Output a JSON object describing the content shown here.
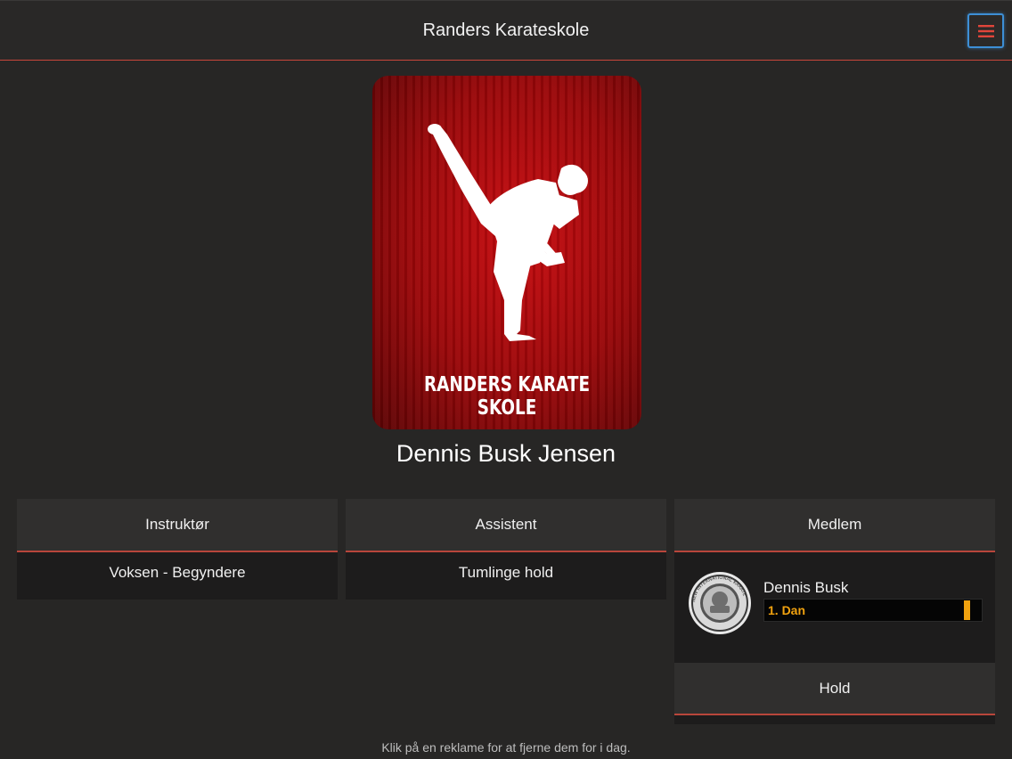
{
  "header": {
    "title": "Randers Karateskole",
    "menu_icon": "hamburger-menu-icon"
  },
  "logo": {
    "text": "RANDERS KARATE SKOLE"
  },
  "profile": {
    "name": "Dennis Busk Jensen"
  },
  "roles": [
    {
      "title": "Instruktør",
      "team": "Voksen - Begyndere"
    },
    {
      "title": "Assistent",
      "team": "Tumlinge hold"
    }
  ],
  "member": {
    "title": "Medlem",
    "name": "Dennis Busk",
    "rank": "1. Dan",
    "rank_color": "#f1a20f",
    "emblem_text": "NEW INTERNATIONAL KARATE",
    "team_label": "Hold"
  },
  "footer": {
    "ad_hint": "Klik på en reklame for at fjerne dem for i dag."
  },
  "colors": {
    "accent": "#c8463a",
    "focus": "#3d8fd6",
    "background": "#272625"
  }
}
